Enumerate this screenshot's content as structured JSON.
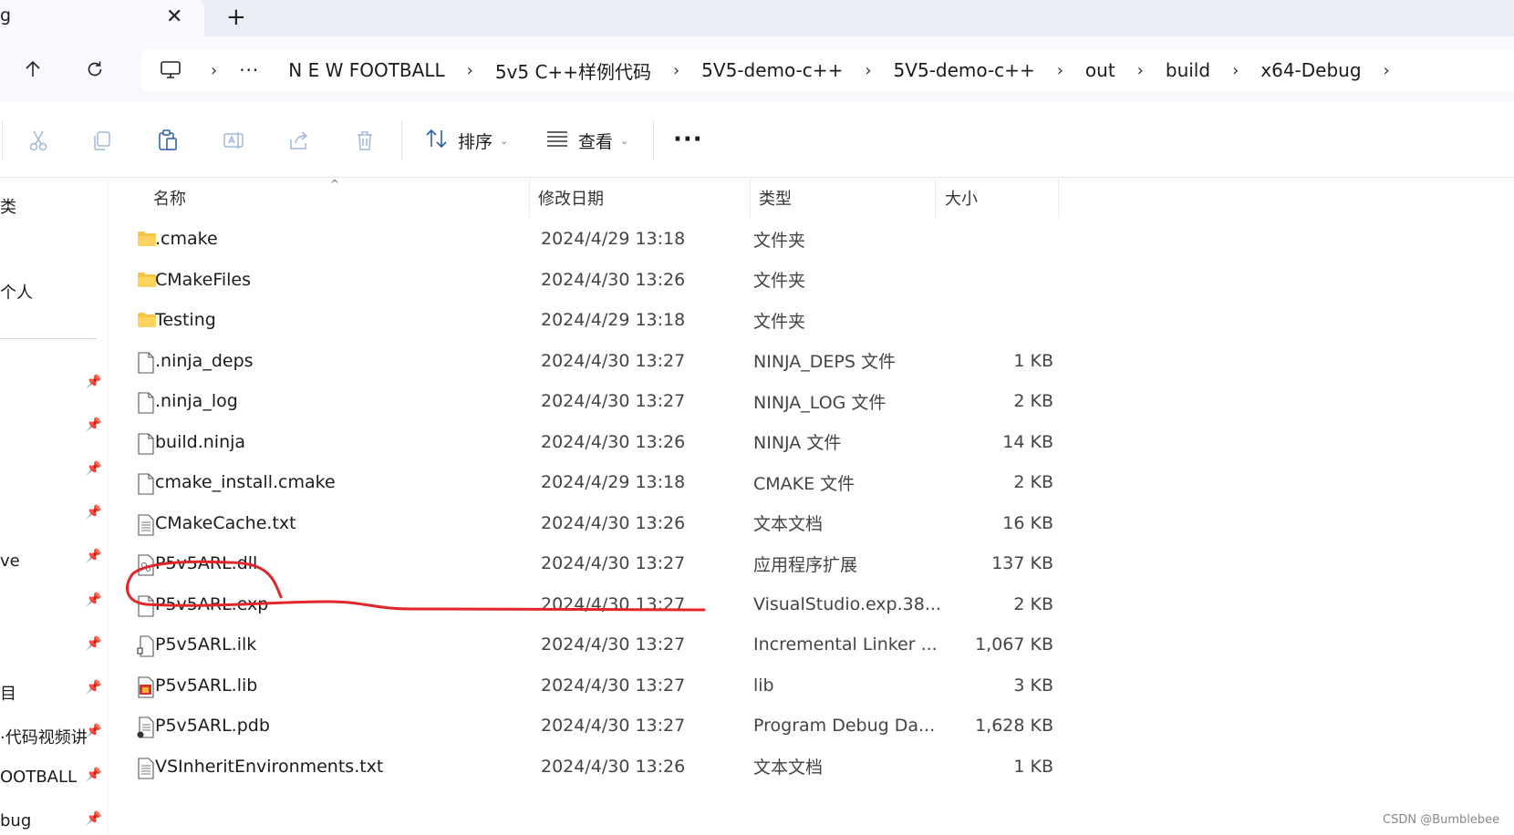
{
  "tab": {
    "title": "g",
    "close_glyph": "✕",
    "new_tab_glyph": "+"
  },
  "address_bar": {
    "more": "···",
    "sep": "›",
    "crumbs": [
      "N E W FOOTBALL",
      "5v5 C++样例代码",
      "5V5-demo-c++",
      "5V5-demo-c++",
      "out",
      "build",
      "x64-Debug"
    ]
  },
  "toolbar": {
    "sort_label": "排序",
    "view_label": "查看",
    "more_label": "···"
  },
  "sidebar": {
    "texts": [
      "类",
      "个人",
      "ve",
      "目",
      "·代码视频讲",
      "OOTBALL",
      "bug"
    ],
    "pin_glyph": "📌"
  },
  "columns": {
    "name": "名称",
    "date": "修改日期",
    "type": "类型",
    "size": "大小"
  },
  "files": [
    {
      "name": ".cmake",
      "date": "2024/4/29 13:18",
      "type": "文件夹",
      "size": "",
      "icon": "folder-icon"
    },
    {
      "name": "CMakeFiles",
      "date": "2024/4/30 13:26",
      "type": "文件夹",
      "size": "",
      "icon": "folder-icon"
    },
    {
      "name": "Testing",
      "date": "2024/4/29 13:18",
      "type": "文件夹",
      "size": "",
      "icon": "folder-icon"
    },
    {
      "name": ".ninja_deps",
      "date": "2024/4/30 13:27",
      "type": "NINJA_DEPS 文件",
      "size": "1 KB",
      "icon": "file-icon"
    },
    {
      "name": ".ninja_log",
      "date": "2024/4/30 13:27",
      "type": "NINJA_LOG 文件",
      "size": "2 KB",
      "icon": "file-icon"
    },
    {
      "name": "build.ninja",
      "date": "2024/4/30 13:26",
      "type": "NINJA 文件",
      "size": "14 KB",
      "icon": "file-icon"
    },
    {
      "name": "cmake_install.cmake",
      "date": "2024/4/29 13:18",
      "type": "CMAKE 文件",
      "size": "2 KB",
      "icon": "file-icon"
    },
    {
      "name": "CMakeCache.txt",
      "date": "2024/4/30 13:26",
      "type": "文本文档",
      "size": "16 KB",
      "icon": "text-file-icon"
    },
    {
      "name": "P5v5ARL.dll",
      "date": "2024/4/30 13:27",
      "type": "应用程序扩展",
      "size": "137 KB",
      "icon": "dll-file-icon"
    },
    {
      "name": "P5v5ARL.exp",
      "date": "2024/4/30 13:27",
      "type": "VisualStudio.exp.38...",
      "size": "2 KB",
      "icon": "file-icon"
    },
    {
      "name": "P5v5ARL.ilk",
      "date": "2024/4/30 13:27",
      "type": "Incremental Linker ...",
      "size": "1,067 KB",
      "icon": "ilk-file-icon"
    },
    {
      "name": "P5v5ARL.lib",
      "date": "2024/4/30 13:27",
      "type": "lib",
      "size": "3 KB",
      "icon": "lib-file-icon"
    },
    {
      "name": "P5v5ARL.pdb",
      "date": "2024/4/30 13:27",
      "type": "Program Debug Da...",
      "size": "1,628 KB",
      "icon": "pdb-file-icon"
    },
    {
      "name": "VSInheritEnvironments.txt",
      "date": "2024/4/30 13:26",
      "type": "文本文档",
      "size": "1 KB",
      "icon": "text-file-icon"
    }
  ],
  "annotation_color": "#e0262b",
  "watermark": "CSDN @Bumblebee"
}
